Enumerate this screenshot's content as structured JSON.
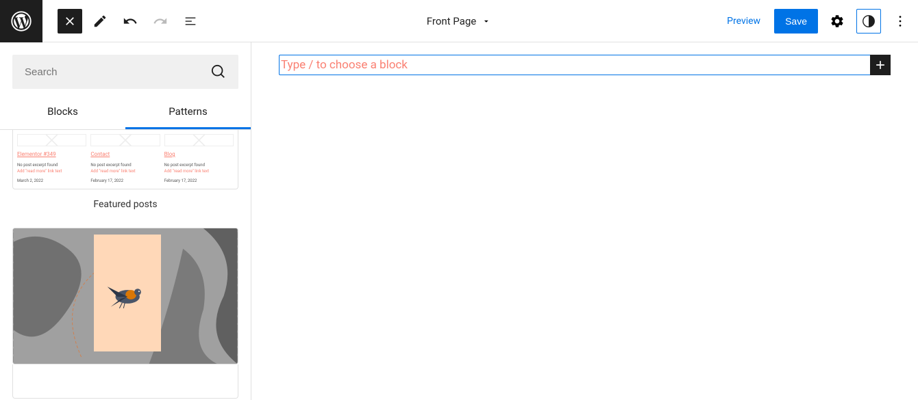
{
  "toolbar": {
    "page_title": "Front Page",
    "preview_label": "Preview",
    "save_label": "Save"
  },
  "sidebar": {
    "search_placeholder": "Search",
    "tabs": {
      "blocks": "Blocks",
      "patterns": "Patterns"
    },
    "pattern_label": "Featured posts",
    "posts": [
      {
        "title": "Elementor #349",
        "excerpt": "No post excerpt found",
        "link": "Add \"read more\" link text",
        "date": "March 2, 2022"
      },
      {
        "title": "Contact",
        "excerpt": "No post excerpt found",
        "link": "Add \"read more\" link text",
        "date": "February 17, 2022"
      },
      {
        "title": "Blog",
        "excerpt": "No post excerpt found",
        "link": "Add \"read more\" link text",
        "date": "February 17, 2022"
      }
    ]
  },
  "editor": {
    "block_placeholder": "Type / to choose a block"
  }
}
